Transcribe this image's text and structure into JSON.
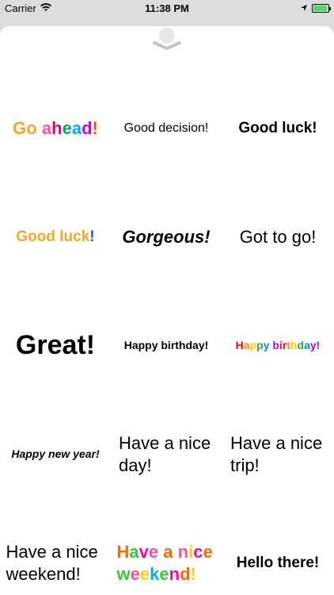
{
  "status_bar": {
    "carrier": "Carrier",
    "time": "11:38 PM",
    "battery_fill_fraction": 0.95,
    "battery_color": "#4cd964"
  },
  "stickers": [
    {
      "text": "Go ahead!",
      "style": "rainbow",
      "colors": [
        "#f5a623",
        "#f5a623",
        "#ffffff",
        "#e5007d",
        "#00aa66",
        "#00aaff",
        "#c000ff",
        "#ff4d00",
        "#ff0000"
      ]
    },
    {
      "text": "Good decision!",
      "style": "black"
    },
    {
      "text": "Good luck!",
      "style": "black-bold"
    },
    {
      "text": "Good luck!",
      "style": "orange-blue"
    },
    {
      "text": "Gorgeous!",
      "style": "black-italic"
    },
    {
      "text": "Got to go!",
      "style": "black"
    },
    {
      "text": "Great!",
      "style": "black-xl"
    },
    {
      "text": "Happy birthday!",
      "style": "black-bold-small"
    },
    {
      "text": "Happy birthday!",
      "style": "rainbow-small",
      "colors": [
        "#ff0000",
        "#ff8800",
        "#ffcc00",
        "#33aa33",
        "#0088ff",
        "#aa00ff",
        "#ff0077",
        "#ff0000",
        "#ff8800",
        "#ffcc00",
        "#33aa33",
        "#0088ff",
        "#aa00ff",
        "#ff0077",
        "#000000"
      ]
    },
    {
      "text": "Happy new year!",
      "style": "black-italic-small"
    },
    {
      "text": "Have a nice day!",
      "style": "black-multiline"
    },
    {
      "text": "Have a nice trip!",
      "style": "black-multiline"
    },
    {
      "text": "Have a nice weekend!",
      "style": "black-multiline"
    },
    {
      "text": "Have a nice weekend!",
      "style": "rainbow-multiline",
      "colors": [
        "#ff6600",
        "#33cc33",
        "#ff00aa",
        "#ffffff",
        "#ff6600",
        "#ffffff",
        "#ffcc00",
        "#ff00aa",
        "#ff6600",
        "#33cc33",
        "#ffffff",
        "#ffcc00",
        "#00aaff",
        "#33cc33",
        "#ff00aa",
        "#ff6600",
        "#ffcc00",
        "#00aaff",
        "#33cc33",
        "#ff00aa"
      ]
    },
    {
      "text": "Hello there!",
      "style": "black-bold"
    }
  ]
}
